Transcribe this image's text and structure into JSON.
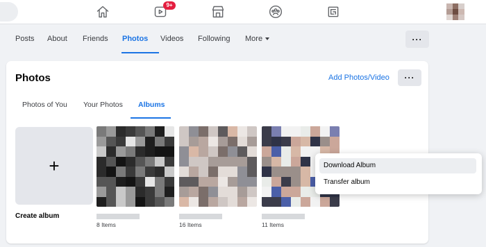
{
  "topbar": {
    "badge_count": "9+",
    "icons": [
      "home-icon",
      "video-icon",
      "marketplace-icon",
      "groups-icon",
      "gaming-icon"
    ]
  },
  "profile_nav": {
    "tabs": [
      "Posts",
      "About",
      "Friends",
      "Photos",
      "Videos",
      "Following",
      "More"
    ],
    "active_tab": "Photos"
  },
  "photos_panel": {
    "title": "Photos",
    "add_link": "Add Photos/Video",
    "tabs": [
      "Photos of You",
      "Your Photos",
      "Albums"
    ],
    "active_tab": "Albums",
    "create_album_label": "Create album",
    "albums": [
      {
        "count": "8 Items"
      },
      {
        "count": "16 Items"
      },
      {
        "count": "11 Items"
      }
    ]
  },
  "context_menu": {
    "items": [
      "Download Album",
      "Transfer album"
    ],
    "highlighted": "Download Album"
  },
  "colors": {
    "accent": "#1b74e4",
    "badge": "#e41e3f",
    "background": "#f0f2f5"
  }
}
